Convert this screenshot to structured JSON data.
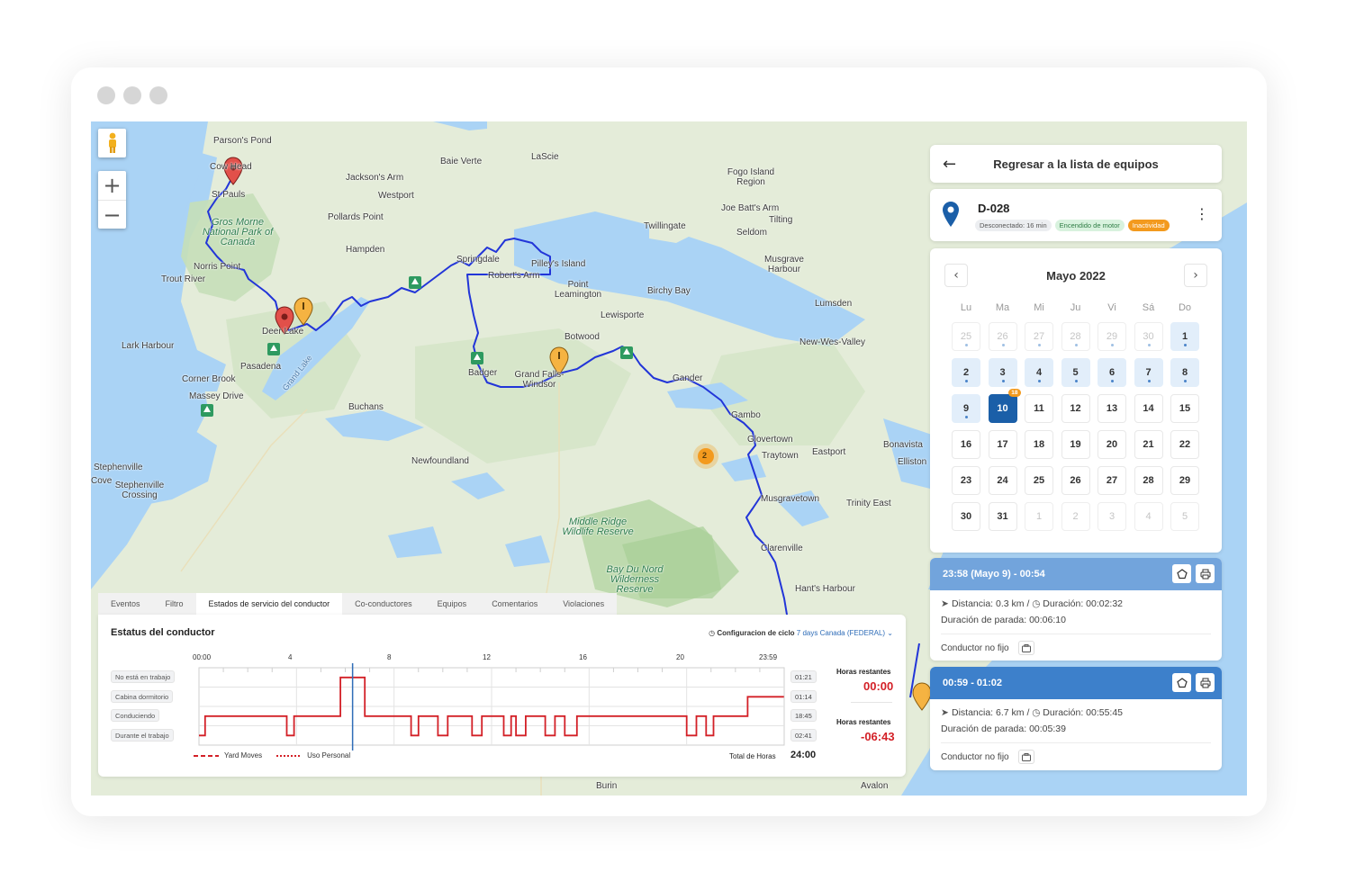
{
  "map": {
    "places": [
      {
        "name": "Parson's Pond"
      },
      {
        "name": "Cow Head"
      },
      {
        "name": "St Pauls"
      },
      {
        "name": "Baie Verte"
      },
      {
        "name": "LaScie"
      },
      {
        "name": "Jackson's Arm"
      },
      {
        "name": "Westport"
      },
      {
        "name": "Pollards Point"
      },
      {
        "name": "Hampden"
      },
      {
        "name": "Fogo Island Region"
      },
      {
        "name": "Joe Batt's Arm"
      },
      {
        "name": "Tilting"
      },
      {
        "name": "Seldom"
      },
      {
        "name": "Twillingate"
      },
      {
        "name": "Musgrave Harbour"
      },
      {
        "name": "Norris Point"
      },
      {
        "name": "Trout River"
      },
      {
        "name": "Springdale"
      },
      {
        "name": "Pilley's Island"
      },
      {
        "name": "Robert's Arm"
      },
      {
        "name": "Point Leamington"
      },
      {
        "name": "Birchy Bay"
      },
      {
        "name": "Lumsden"
      },
      {
        "name": "Lewisporte"
      },
      {
        "name": "Deer Lake"
      },
      {
        "name": "Lark Harbour"
      },
      {
        "name": "Botwood"
      },
      {
        "name": "New-Wes-Valley"
      },
      {
        "name": "Pasadena"
      },
      {
        "name": "Badger"
      },
      {
        "name": "Grand Falls-Windsor"
      },
      {
        "name": "Gander"
      },
      {
        "name": "Corner Brook"
      },
      {
        "name": "Massey Drive"
      },
      {
        "name": "Buchans"
      },
      {
        "name": "Gambo"
      },
      {
        "name": "Glovertown"
      },
      {
        "name": "Traytown"
      },
      {
        "name": "Eastport"
      },
      {
        "name": "Bonavista"
      },
      {
        "name": "Elliston"
      },
      {
        "name": "Stephenville"
      },
      {
        "name": "Cove"
      },
      {
        "name": "Stephenville Crossing"
      },
      {
        "name": "Newfoundland"
      },
      {
        "name": "Musgravetown"
      },
      {
        "name": "Trinity East"
      },
      {
        "name": "Clarenville"
      },
      {
        "name": "Hant's Harbour"
      },
      {
        "name": "Burin"
      },
      {
        "name": "Avalon"
      },
      {
        "name": "Grand Lake"
      }
    ],
    "parks": [
      {
        "name": "Gros Morne National Park of Canada"
      },
      {
        "name": "Middle Ridge Wildlife Reserve"
      },
      {
        "name": "Bay Du Nord Wilderness Reserve"
      }
    ],
    "cluster_count": "2",
    "controls": {
      "zoom_in": "+",
      "zoom_out": "−"
    }
  },
  "panel": {
    "back_label": "Regresar a la lista de equipos",
    "unit": {
      "name": "D-028",
      "badges": [
        {
          "text": "Desconectado: 16 min",
          "style": "gray"
        },
        {
          "text": "Encendido de motor",
          "style": "green"
        },
        {
          "text": "Inactividad",
          "style": "orange"
        }
      ]
    },
    "calendar": {
      "title": "Mayo 2022",
      "weekdays": [
        "Lu",
        "Ma",
        "Mi",
        "Ju",
        "Vi",
        "Sá",
        "Do"
      ],
      "days": [
        {
          "d": "25",
          "muted": true,
          "data": true
        },
        {
          "d": "26",
          "muted": true,
          "data": true
        },
        {
          "d": "27",
          "muted": true,
          "data": true
        },
        {
          "d": "28",
          "muted": true,
          "data": true
        },
        {
          "d": "29",
          "muted": true,
          "data": true
        },
        {
          "d": "30",
          "muted": true,
          "data": true
        },
        {
          "d": "1",
          "data": true
        },
        {
          "d": "2",
          "data": true
        },
        {
          "d": "3",
          "data": true
        },
        {
          "d": "4",
          "data": true
        },
        {
          "d": "5",
          "data": true
        },
        {
          "d": "6",
          "data": true
        },
        {
          "d": "7",
          "data": true
        },
        {
          "d": "8",
          "data": true
        },
        {
          "d": "9",
          "data": true
        },
        {
          "d": "10",
          "selected": true,
          "count": "18"
        },
        {
          "d": "11"
        },
        {
          "d": "12"
        },
        {
          "d": "13"
        },
        {
          "d": "14"
        },
        {
          "d": "15"
        },
        {
          "d": "16"
        },
        {
          "d": "17"
        },
        {
          "d": "18"
        },
        {
          "d": "19"
        },
        {
          "d": "20"
        },
        {
          "d": "21"
        },
        {
          "d": "22"
        },
        {
          "d": "23"
        },
        {
          "d": "24"
        },
        {
          "d": "25"
        },
        {
          "d": "26"
        },
        {
          "d": "27"
        },
        {
          "d": "28"
        },
        {
          "d": "29"
        },
        {
          "d": "30"
        },
        {
          "d": "31"
        },
        {
          "d": "1",
          "muted": true
        },
        {
          "d": "2",
          "muted": true
        },
        {
          "d": "3",
          "muted": true
        },
        {
          "d": "4",
          "muted": true
        },
        {
          "d": "5",
          "muted": true
        }
      ]
    },
    "trips": [
      {
        "title": "23:58 (Mayo 9) - 00:54",
        "distance": "Distancia: 0.3 km",
        "duration": "Duración: 00:02:32",
        "stop": "Duración de parada: 00:06:10",
        "driver": "Conductor no fijo"
      },
      {
        "title": "00:59 - 01:02",
        "distance": "Distancia: 6.7 km",
        "duration": "Duración: 00:55:45",
        "stop": "Duración de parada: 00:05:39",
        "driver": "Conductor no fijo"
      }
    ]
  },
  "bottom": {
    "tabs": [
      {
        "label": "Eventos"
      },
      {
        "label": "Filtro"
      },
      {
        "label": "Estados de servicio del conductor",
        "active": true
      },
      {
        "label": "Co-conductores"
      },
      {
        "label": "Equipos"
      },
      {
        "label": "Comentarios"
      },
      {
        "label": "Violaciones"
      }
    ],
    "status": {
      "title": "Estatus del conductor",
      "cycle_label": "Configuracion de ciclo",
      "cycle_value": "7 days Canada (FEDERAL)",
      "hour_ticks": [
        "00:00",
        "4",
        "8",
        "12",
        "16",
        "20",
        "23:59"
      ],
      "rows": [
        {
          "label": "No está en trabajo",
          "total": "01:21"
        },
        {
          "label": "Cabina dormitorio",
          "total": "01:14"
        },
        {
          "label": "Conduciendo",
          "total": "18:45"
        },
        {
          "label": "Durante el trabajo",
          "total": "02:41"
        }
      ],
      "remaining": [
        {
          "label": "Horas restantes",
          "value": "00:00"
        },
        {
          "label": "Horas restantes",
          "value": "-06:43"
        }
      ],
      "legend": [
        "Yard Moves",
        "Uso Personal"
      ],
      "total_label": "Total de Horas",
      "total_value": "24:00",
      "current_time_hour": 6.3,
      "segments": [
        [
          0,
          3
        ],
        [
          0.25,
          3
        ],
        [
          0.25,
          2
        ],
        [
          3.6,
          2
        ],
        [
          3.6,
          3
        ],
        [
          3.9,
          3
        ],
        [
          3.9,
          2
        ],
        [
          5.8,
          2
        ],
        [
          5.8,
          0
        ],
        [
          6.8,
          0
        ],
        [
          6.8,
          2
        ],
        [
          8.7,
          2
        ],
        [
          8.7,
          3
        ],
        [
          9.0,
          3
        ],
        [
          9.0,
          2
        ],
        [
          9.8,
          2
        ],
        [
          9.8,
          3
        ],
        [
          10.2,
          3
        ],
        [
          10.2,
          2
        ],
        [
          11.2,
          2
        ],
        [
          11.2,
          3
        ],
        [
          11.6,
          3
        ],
        [
          11.6,
          2
        ],
        [
          12.5,
          2
        ],
        [
          12.5,
          3
        ],
        [
          12.8,
          3
        ],
        [
          12.8,
          2
        ],
        [
          13.0,
          2
        ],
        [
          13.0,
          3
        ],
        [
          13.4,
          3
        ],
        [
          13.4,
          2
        ],
        [
          14.2,
          2
        ],
        [
          14.2,
          3
        ],
        [
          14.6,
          3
        ],
        [
          14.6,
          2
        ],
        [
          15.0,
          2
        ],
        [
          15.0,
          3
        ],
        [
          15.5,
          3
        ],
        [
          15.5,
          2
        ],
        [
          20.0,
          2
        ],
        [
          20.0,
          3
        ],
        [
          20.4,
          3
        ],
        [
          20.4,
          2
        ],
        [
          20.8,
          2
        ],
        [
          20.8,
          3
        ],
        [
          21.1,
          3
        ],
        [
          21.1,
          2
        ],
        [
          22.5,
          2
        ],
        [
          22.5,
          1
        ],
        [
          23.99,
          1
        ]
      ]
    }
  },
  "colors": {
    "accent": "#1b5fa8",
    "route": "#2235d8",
    "hos_line": "#d32027",
    "orange": "#f39a1e",
    "water": "#aad3f5",
    "land": "#e6eedd"
  }
}
